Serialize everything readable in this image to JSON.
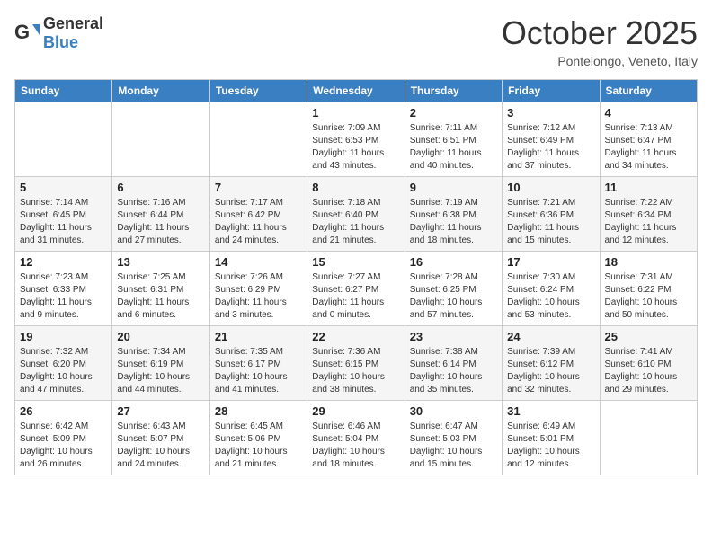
{
  "header": {
    "logo": {
      "general": "General",
      "blue": "Blue"
    },
    "title": "October 2025",
    "subtitle": "Pontelongo, Veneto, Italy"
  },
  "weekdays": [
    "Sunday",
    "Monday",
    "Tuesday",
    "Wednesday",
    "Thursday",
    "Friday",
    "Saturday"
  ],
  "weeks": [
    [
      {
        "day": "",
        "info": ""
      },
      {
        "day": "",
        "info": ""
      },
      {
        "day": "",
        "info": ""
      },
      {
        "day": "1",
        "info": "Sunrise: 7:09 AM\nSunset: 6:53 PM\nDaylight: 11 hours\nand 43 minutes."
      },
      {
        "day": "2",
        "info": "Sunrise: 7:11 AM\nSunset: 6:51 PM\nDaylight: 11 hours\nand 40 minutes."
      },
      {
        "day": "3",
        "info": "Sunrise: 7:12 AM\nSunset: 6:49 PM\nDaylight: 11 hours\nand 37 minutes."
      },
      {
        "day": "4",
        "info": "Sunrise: 7:13 AM\nSunset: 6:47 PM\nDaylight: 11 hours\nand 34 minutes."
      }
    ],
    [
      {
        "day": "5",
        "info": "Sunrise: 7:14 AM\nSunset: 6:45 PM\nDaylight: 11 hours\nand 31 minutes."
      },
      {
        "day": "6",
        "info": "Sunrise: 7:16 AM\nSunset: 6:44 PM\nDaylight: 11 hours\nand 27 minutes."
      },
      {
        "day": "7",
        "info": "Sunrise: 7:17 AM\nSunset: 6:42 PM\nDaylight: 11 hours\nand 24 minutes."
      },
      {
        "day": "8",
        "info": "Sunrise: 7:18 AM\nSunset: 6:40 PM\nDaylight: 11 hours\nand 21 minutes."
      },
      {
        "day": "9",
        "info": "Sunrise: 7:19 AM\nSunset: 6:38 PM\nDaylight: 11 hours\nand 18 minutes."
      },
      {
        "day": "10",
        "info": "Sunrise: 7:21 AM\nSunset: 6:36 PM\nDaylight: 11 hours\nand 15 minutes."
      },
      {
        "day": "11",
        "info": "Sunrise: 7:22 AM\nSunset: 6:34 PM\nDaylight: 11 hours\nand 12 minutes."
      }
    ],
    [
      {
        "day": "12",
        "info": "Sunrise: 7:23 AM\nSunset: 6:33 PM\nDaylight: 11 hours\nand 9 minutes."
      },
      {
        "day": "13",
        "info": "Sunrise: 7:25 AM\nSunset: 6:31 PM\nDaylight: 11 hours\nand 6 minutes."
      },
      {
        "day": "14",
        "info": "Sunrise: 7:26 AM\nSunset: 6:29 PM\nDaylight: 11 hours\nand 3 minutes."
      },
      {
        "day": "15",
        "info": "Sunrise: 7:27 AM\nSunset: 6:27 PM\nDaylight: 11 hours\nand 0 minutes."
      },
      {
        "day": "16",
        "info": "Sunrise: 7:28 AM\nSunset: 6:25 PM\nDaylight: 10 hours\nand 57 minutes."
      },
      {
        "day": "17",
        "info": "Sunrise: 7:30 AM\nSunset: 6:24 PM\nDaylight: 10 hours\nand 53 minutes."
      },
      {
        "day": "18",
        "info": "Sunrise: 7:31 AM\nSunset: 6:22 PM\nDaylight: 10 hours\nand 50 minutes."
      }
    ],
    [
      {
        "day": "19",
        "info": "Sunrise: 7:32 AM\nSunset: 6:20 PM\nDaylight: 10 hours\nand 47 minutes."
      },
      {
        "day": "20",
        "info": "Sunrise: 7:34 AM\nSunset: 6:19 PM\nDaylight: 10 hours\nand 44 minutes."
      },
      {
        "day": "21",
        "info": "Sunrise: 7:35 AM\nSunset: 6:17 PM\nDaylight: 10 hours\nand 41 minutes."
      },
      {
        "day": "22",
        "info": "Sunrise: 7:36 AM\nSunset: 6:15 PM\nDaylight: 10 hours\nand 38 minutes."
      },
      {
        "day": "23",
        "info": "Sunrise: 7:38 AM\nSunset: 6:14 PM\nDaylight: 10 hours\nand 35 minutes."
      },
      {
        "day": "24",
        "info": "Sunrise: 7:39 AM\nSunset: 6:12 PM\nDaylight: 10 hours\nand 32 minutes."
      },
      {
        "day": "25",
        "info": "Sunrise: 7:41 AM\nSunset: 6:10 PM\nDaylight: 10 hours\nand 29 minutes."
      }
    ],
    [
      {
        "day": "26",
        "info": "Sunrise: 6:42 AM\nSunset: 5:09 PM\nDaylight: 10 hours\nand 26 minutes."
      },
      {
        "day": "27",
        "info": "Sunrise: 6:43 AM\nSunset: 5:07 PM\nDaylight: 10 hours\nand 24 minutes."
      },
      {
        "day": "28",
        "info": "Sunrise: 6:45 AM\nSunset: 5:06 PM\nDaylight: 10 hours\nand 21 minutes."
      },
      {
        "day": "29",
        "info": "Sunrise: 6:46 AM\nSunset: 5:04 PM\nDaylight: 10 hours\nand 18 minutes."
      },
      {
        "day": "30",
        "info": "Sunrise: 6:47 AM\nSunset: 5:03 PM\nDaylight: 10 hours\nand 15 minutes."
      },
      {
        "day": "31",
        "info": "Sunrise: 6:49 AM\nSunset: 5:01 PM\nDaylight: 10 hours\nand 12 minutes."
      },
      {
        "day": "",
        "info": ""
      }
    ]
  ]
}
